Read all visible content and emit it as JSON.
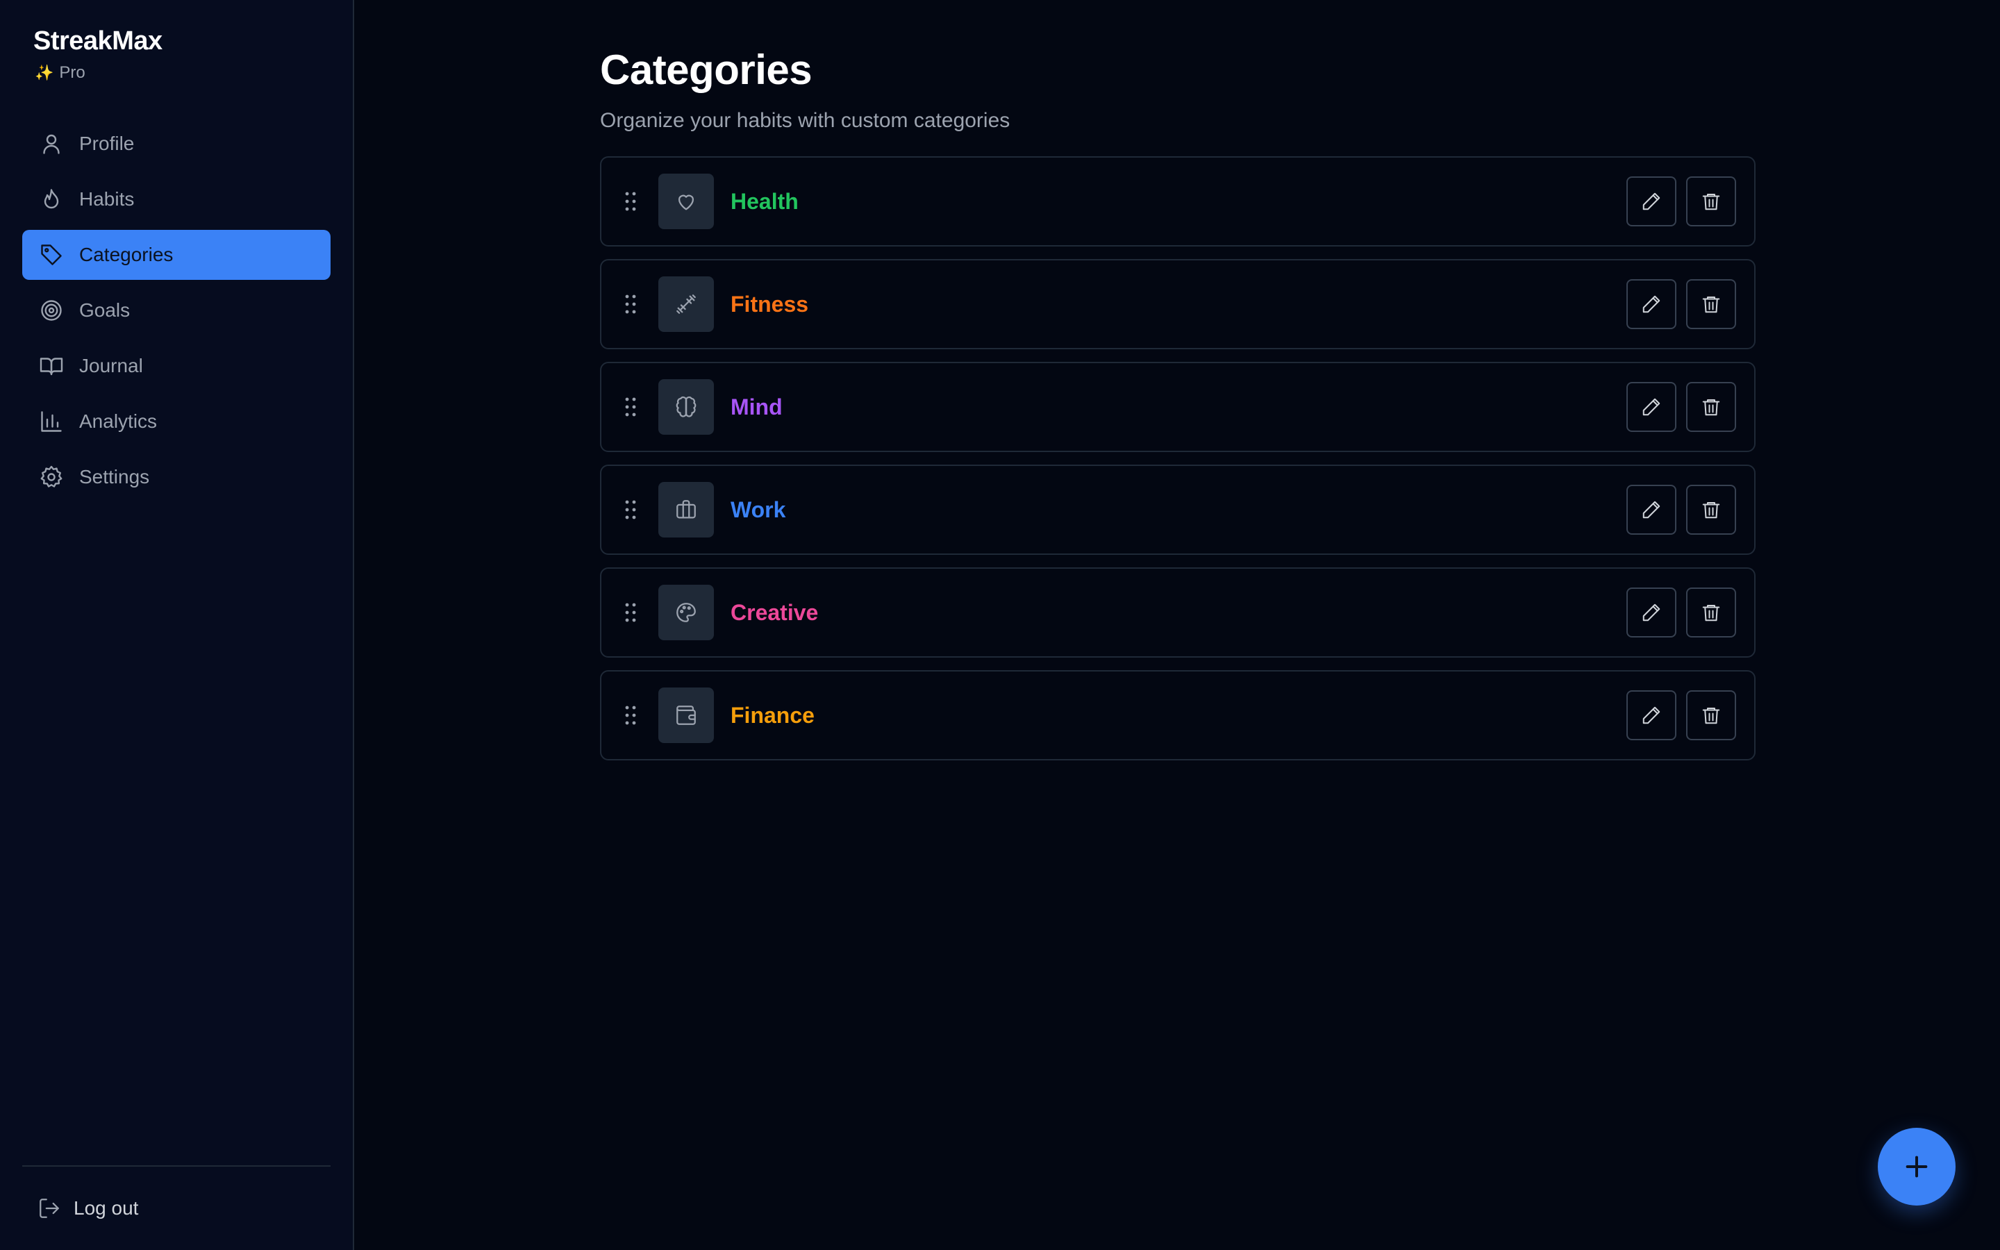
{
  "brand": {
    "name": "StreakMax",
    "badge_icon": "sparkles-icon",
    "badge": "Pro"
  },
  "nav": {
    "items": [
      {
        "label": "Profile",
        "icon": "user-icon",
        "active": false
      },
      {
        "label": "Habits",
        "icon": "flame-icon",
        "active": false
      },
      {
        "label": "Categories",
        "icon": "tag-icon",
        "active": true
      },
      {
        "label": "Goals",
        "icon": "target-icon",
        "active": false
      },
      {
        "label": "Journal",
        "icon": "book-icon",
        "active": false
      },
      {
        "label": "Analytics",
        "icon": "bar-chart-icon",
        "active": false
      },
      {
        "label": "Settings",
        "icon": "gear-icon",
        "active": false
      }
    ],
    "logout": {
      "label": "Log out",
      "icon": "logout-icon"
    }
  },
  "page": {
    "title": "Categories",
    "subtitle": "Organize your habits with custom categories"
  },
  "categories": [
    {
      "name": "Health",
      "icon": "heart-icon",
      "color": "#22c55e"
    },
    {
      "name": "Fitness",
      "icon": "dumbbell-icon",
      "color": "#f97316"
    },
    {
      "name": "Mind",
      "icon": "brain-icon",
      "color": "#a855f7"
    },
    {
      "name": "Work",
      "icon": "briefcase-icon",
      "color": "#3b82f6"
    },
    {
      "name": "Creative",
      "icon": "palette-icon",
      "color": "#ec4899"
    },
    {
      "name": "Finance",
      "icon": "wallet-icon",
      "color": "#f59e0b"
    }
  ],
  "row_actions": {
    "edit_icon": "pencil-icon",
    "delete_icon": "trash-icon"
  },
  "fab": {
    "icon": "plus-icon"
  },
  "colors": {
    "accent": "#3b82f6",
    "background": "#030712",
    "sidebar": "#060c1f",
    "border": "#1f2937"
  }
}
